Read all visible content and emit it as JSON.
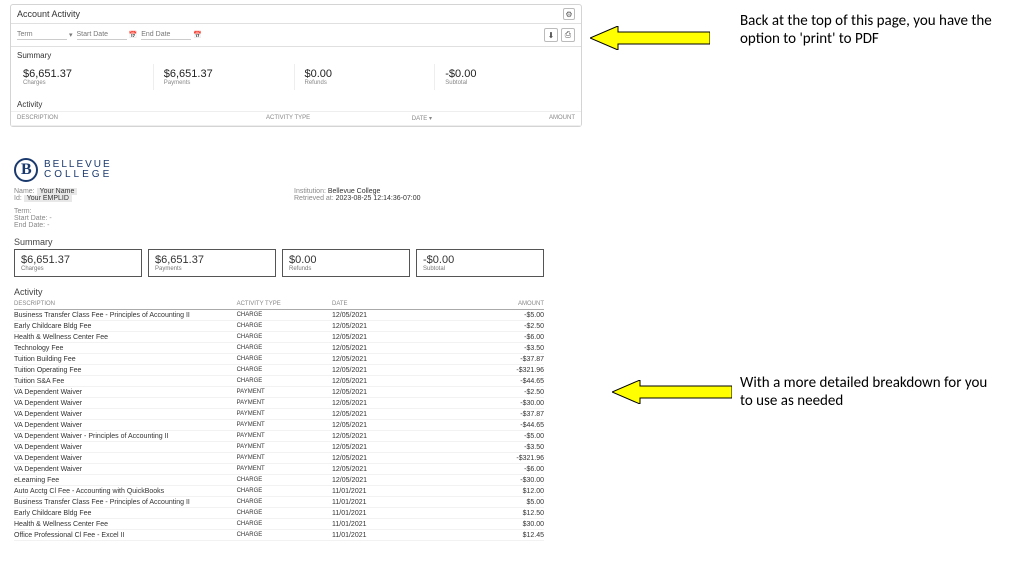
{
  "annotations": {
    "top": "Back at the top of this page, you have the option to 'print' to PDF",
    "bottom": "With a more detailed breakdown for you to use as needed"
  },
  "app_panel": {
    "title": "Account Activity",
    "filters": {
      "term_label": "Term",
      "start_label": "Start Date",
      "end_label": "End Date"
    },
    "icons": {
      "gear": "⚙",
      "download": "⬇",
      "print": "⎙",
      "chevron": "▾",
      "calendar": "📅"
    },
    "summary_title": "Summary",
    "summary": [
      {
        "amount": "$6,651.37",
        "label": "Charges"
      },
      {
        "amount": "$6,651.37",
        "label": "Payments"
      },
      {
        "amount": "$0.00",
        "label": "Refunds"
      },
      {
        "amount": "-$0.00",
        "label": "Subtotal"
      }
    ],
    "activity_title": "Activity",
    "cols": {
      "desc": "Description",
      "type": "Activity Type",
      "date": "Date ▾",
      "amount": "Amount"
    }
  },
  "report": {
    "logo": {
      "line1": "BELLEVUE",
      "line2": "COLLEGE"
    },
    "meta_left": [
      {
        "label": "Name:",
        "value": "Your Name"
      },
      {
        "label": "Id:",
        "value": "Your EMPLID"
      }
    ],
    "meta_right": [
      {
        "label": "Institution:",
        "value": "Bellevue College"
      },
      {
        "label": "Retrieved at:",
        "value": "2023-08-25 12:14:36-07:00"
      }
    ],
    "term_line": "Term:",
    "start_line": "Start Date: -",
    "end_line": "End Date: -",
    "summary_title": "Summary",
    "summary": [
      {
        "amount": "$6,651.37",
        "label": "Charges"
      },
      {
        "amount": "$6,651.37",
        "label": "Payments"
      },
      {
        "amount": "$0.00",
        "label": "Refunds"
      },
      {
        "amount": "-$0.00",
        "label": "Subtotal"
      }
    ],
    "activity_title": "Activity",
    "cols": {
      "desc": "Description",
      "type": "Activity Type",
      "date": "Date",
      "amount": "Amount"
    },
    "rows": [
      {
        "desc": "Business Transfer Class Fee - Principles of Accounting II",
        "type": "Charge",
        "date": "12/05/2021",
        "amount": "-$5.00"
      },
      {
        "desc": "Early Childcare Bldg Fee",
        "type": "Charge",
        "date": "12/05/2021",
        "amount": "-$2.50"
      },
      {
        "desc": "Health & Wellness Center Fee",
        "type": "Charge",
        "date": "12/05/2021",
        "amount": "-$6.00"
      },
      {
        "desc": "Technology Fee",
        "type": "Charge",
        "date": "12/05/2021",
        "amount": "-$3.50"
      },
      {
        "desc": "Tuition Building Fee",
        "type": "Charge",
        "date": "12/05/2021",
        "amount": "-$37.87"
      },
      {
        "desc": "Tuition Operating Fee",
        "type": "Charge",
        "date": "12/05/2021",
        "amount": "-$321.96"
      },
      {
        "desc": "Tuition S&A Fee",
        "type": "Charge",
        "date": "12/05/2021",
        "amount": "-$44.65"
      },
      {
        "desc": "VA Dependent Waiver",
        "type": "Payment",
        "date": "12/05/2021",
        "amount": "-$2.50"
      },
      {
        "desc": "VA Dependent Waiver",
        "type": "Payment",
        "date": "12/05/2021",
        "amount": "-$30.00"
      },
      {
        "desc": "VA Dependent Waiver",
        "type": "Payment",
        "date": "12/05/2021",
        "amount": "-$37.87"
      },
      {
        "desc": "VA Dependent Waiver",
        "type": "Payment",
        "date": "12/05/2021",
        "amount": "-$44.65"
      },
      {
        "desc": "VA Dependent Waiver - Principles of Accounting II",
        "type": "Payment",
        "date": "12/05/2021",
        "amount": "-$5.00"
      },
      {
        "desc": "VA Dependent Waiver",
        "type": "Payment",
        "date": "12/05/2021",
        "amount": "-$3.50"
      },
      {
        "desc": "VA Dependent Waiver",
        "type": "Payment",
        "date": "12/05/2021",
        "amount": "-$321.96"
      },
      {
        "desc": "VA Dependent Waiver",
        "type": "Payment",
        "date": "12/05/2021",
        "amount": "-$6.00"
      },
      {
        "desc": "eLearning Fee",
        "type": "Charge",
        "date": "12/05/2021",
        "amount": "-$30.00"
      },
      {
        "desc": "Auto Acctg Cl Fee - Accounting with QuickBooks",
        "type": "Charge",
        "date": "11/01/2021",
        "amount": "$12.00"
      },
      {
        "desc": "Business Transfer Class Fee - Principles of Accounting II",
        "type": "Charge",
        "date": "11/01/2021",
        "amount": "$5.00"
      },
      {
        "desc": "Early Childcare Bldg Fee",
        "type": "Charge",
        "date": "11/01/2021",
        "amount": "$12.50"
      },
      {
        "desc": "Health & Wellness Center Fee",
        "type": "Charge",
        "date": "11/01/2021",
        "amount": "$30.00"
      },
      {
        "desc": "Office Professional Cl Fee - Excel II",
        "type": "Charge",
        "date": "11/01/2021",
        "amount": "$12.45"
      }
    ]
  }
}
